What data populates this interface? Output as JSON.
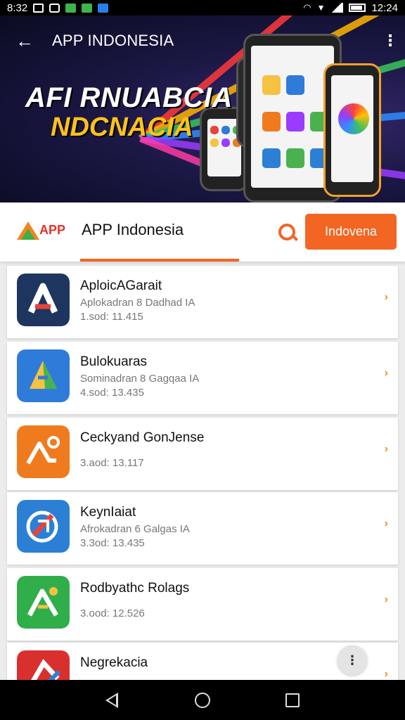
{
  "status_bar": {
    "time_left": "8:32",
    "time_right": "12:24"
  },
  "app_bar": {
    "title": "APP INDONESIA",
    "back_icon": "arrow-left-icon",
    "more_icon": "more-vert-icon"
  },
  "banner": {
    "line1": "AFI RNUABCIA",
    "line2": "NDCNACIA"
  },
  "header": {
    "logo_text": "APP",
    "title": "APP Indonesia",
    "search_icon": "search-icon",
    "button_label": "Indovena"
  },
  "apps": [
    {
      "name": "AploicAGarait",
      "subtitle": "Aplokadran 8 Dadhad IA",
      "meta": "1.sod:  11.415",
      "icon_colors": [
        "#1e3560",
        "#e8433a",
        "#ffffff"
      ]
    },
    {
      "name": "Bulokuaras",
      "subtitle": "Sominadran 8 Gagqaa IA",
      "meta": "4.sod:  13.435",
      "icon_colors": [
        "#2f7bd9",
        "#f5c242",
        "#49b24f"
      ]
    },
    {
      "name": "Ceckyand GonJense",
      "subtitle": "",
      "meta": "3.aod:  13.117",
      "icon_colors": [
        "#f07b1e",
        "#ffffff",
        "#ffffff"
      ]
    },
    {
      "name": "KeynIaiat",
      "subtitle": "Afrokadran 6 Galgas IA",
      "meta": "3.3od:  13.435",
      "icon_colors": [
        "#2b80d6",
        "#e8433a",
        "#ffffff"
      ]
    },
    {
      "name": "Rodbyathc Rolags",
      "subtitle": "",
      "meta": "3.ood:  12.526",
      "icon_colors": [
        "#2fae4a",
        "#f5c242",
        "#ffffff"
      ]
    },
    {
      "name": "Negrekacia",
      "subtitle": "",
      "meta": "",
      "icon_colors": [
        "#d9302e",
        "#2b80d6",
        "#ffffff"
      ]
    }
  ],
  "accent_color": "#f26522",
  "nav": {
    "back_icon": "nav-back-icon",
    "home_icon": "nav-home-icon",
    "recent_icon": "nav-recent-icon"
  }
}
